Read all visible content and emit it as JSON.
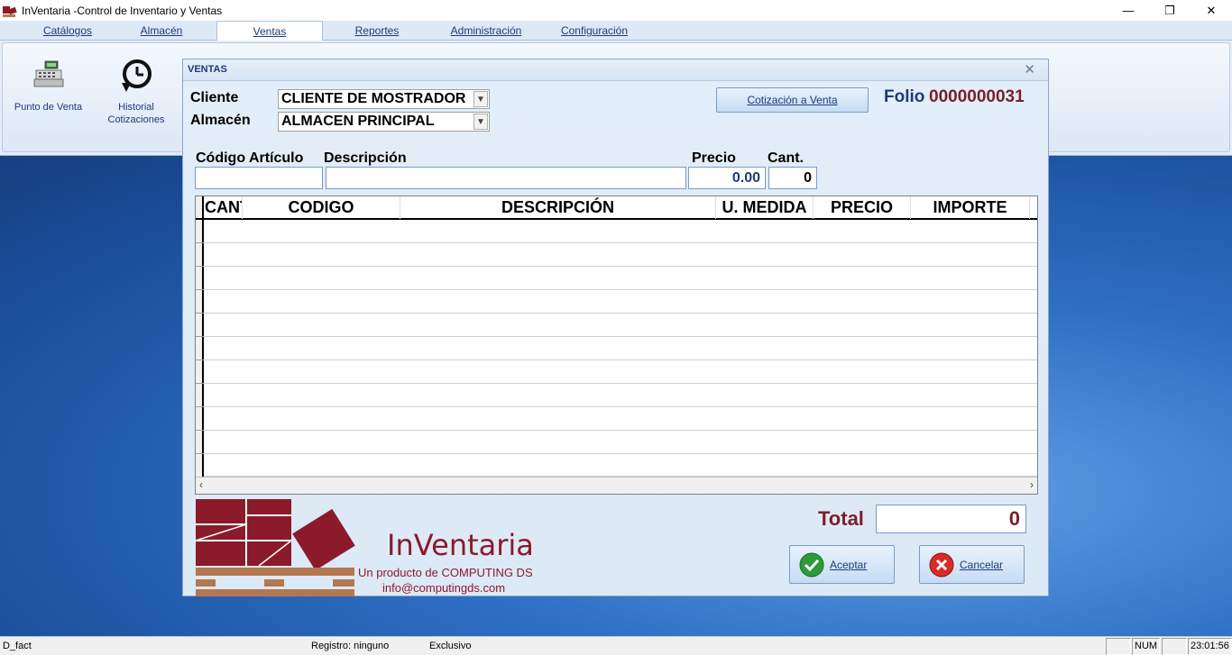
{
  "window": {
    "title": "InVentaria -Control de Inventario y Ventas",
    "min": "—",
    "max": "❐",
    "close": "✕"
  },
  "menu": [
    {
      "label": "Catálogos"
    },
    {
      "label": "Almacén"
    },
    {
      "label": "Ventas"
    },
    {
      "label": "Reportes"
    },
    {
      "label": "Administración"
    },
    {
      "label": "Configuración"
    }
  ],
  "ribbon": {
    "pos_label": "Punto de Venta",
    "hist_label_1": "Historial",
    "hist_label_2": "Cotizaciones",
    "pos_icon": "cash-register-icon",
    "hist_icon": "clock-history-icon"
  },
  "dialog": {
    "title": "VENTAS",
    "close": "✕",
    "cliente_label": "Cliente",
    "cliente_value": "CLIENTE DE MOSTRADOR",
    "almacen_label": "Almacén",
    "almacen_value": "ALMACEN PRINCIPAL",
    "cotizacion_button": "Cotización a Venta",
    "folio_label": "Folio",
    "folio_value": "0000000031",
    "codigo_label": "Código Artículo",
    "descripcion_label": "Descripción",
    "precio_label": "Precio",
    "cant_label": "Cant.",
    "precio_value": "0.00",
    "cant_value": "0",
    "columns": [
      "CANT",
      "CODIGO",
      "DESCRIPCIÓN",
      "U. MEDIDA",
      "PRECIO",
      "IMPORTE"
    ],
    "total_label": "Total",
    "total_value": "0",
    "aceptar_label": "Aceptar",
    "cancelar_label": "Cancelar"
  },
  "logo": {
    "name": "InVentaria",
    "sub1": "Un producto de COMPUTING DS",
    "sub2": "info@computingds.com"
  },
  "status": {
    "left": "D_fact",
    "registro": "Registro: ninguno",
    "modo": "Exclusivo",
    "num": "NUM",
    "time": "23:01:56"
  },
  "colors": {
    "accent": "#1e3a78",
    "brand": "#8b1a2b"
  }
}
